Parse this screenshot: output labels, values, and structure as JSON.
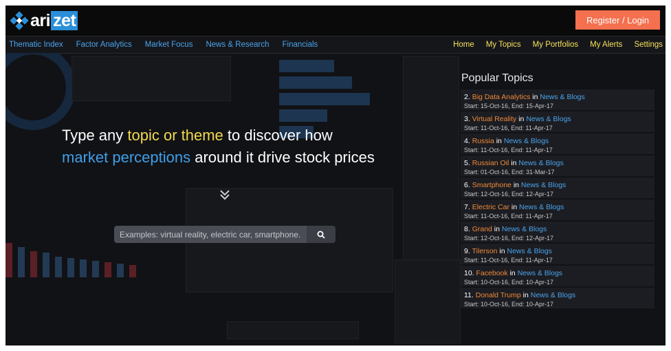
{
  "header": {
    "logo_text_a": "ari",
    "logo_text_b": "zet",
    "register_label": "Register / Login"
  },
  "nav": {
    "left": [
      "Thematic Index",
      "Factor Analytics",
      "Market Focus",
      "News & Research",
      "Financials"
    ],
    "right": [
      "Home",
      "My Topics",
      "My Portfolios",
      "My Alerts",
      "Settings"
    ]
  },
  "hero": {
    "line1_pre": "Type any ",
    "line1_hl": "topic or theme",
    "line1_post": " to discover how",
    "line2_hl": "market perceptions",
    "line2_post": " around it drive stock prices"
  },
  "search": {
    "placeholder": "Examples: virtual reality, electric car, smartphone..."
  },
  "topics": {
    "title": "Popular Topics",
    "items": [
      {
        "num": "2.",
        "name": "Big Data Analytics",
        "src": "News & Blogs",
        "dates": "Start: 15-Oct-16, End: 15-Apr-17"
      },
      {
        "num": "3.",
        "name": "Virtual Reality",
        "src": "News & Blogs",
        "dates": "Start: 11-Oct-16, End: 11-Apr-17"
      },
      {
        "num": "4.",
        "name": "Russia",
        "src": "News & Blogs",
        "dates": "Start: 11-Oct-16, End: 11-Apr-17"
      },
      {
        "num": "5.",
        "name": "Russian Oil",
        "src": "News & Blogs",
        "dates": "Start: 01-Oct-16, End: 31-Mar-17"
      },
      {
        "num": "6.",
        "name": "Smartphone",
        "src": "News & Blogs",
        "dates": "Start: 12-Oct-16, End: 12-Apr-17"
      },
      {
        "num": "7.",
        "name": "Electric Car",
        "src": "News & Blogs",
        "dates": "Start: 11-Oct-16, End: 11-Apr-17"
      },
      {
        "num": "8.",
        "name": "Grand",
        "src": "News & Blogs",
        "dates": "Start: 12-Oct-16, End: 12-Apr-17"
      },
      {
        "num": "9.",
        "name": "Tilerson",
        "src": "News & Blogs",
        "dates": "Start: 11-Oct-16, End: 11-Apr-17"
      },
      {
        "num": "10.",
        "name": "Facebook",
        "src": "News & Blogs",
        "dates": "Start: 10-Oct-16, End: 10-Apr-17"
      },
      {
        "num": "11.",
        "name": "Donald Trump",
        "src": "News & Blogs",
        "dates": "Start: 10-Oct-16, End: 10-Apr-17"
      }
    ],
    "in_word": "in"
  },
  "colors": {
    "accent_blue": "#3f9fe8",
    "accent_yellow": "#f2d94e",
    "topic_orange": "#f08a3a",
    "register_bg": "#f4704f"
  },
  "icons": {
    "logo": "logo-diamond-icon",
    "chevron": "double-chevron-down-icon",
    "search": "search-icon"
  }
}
